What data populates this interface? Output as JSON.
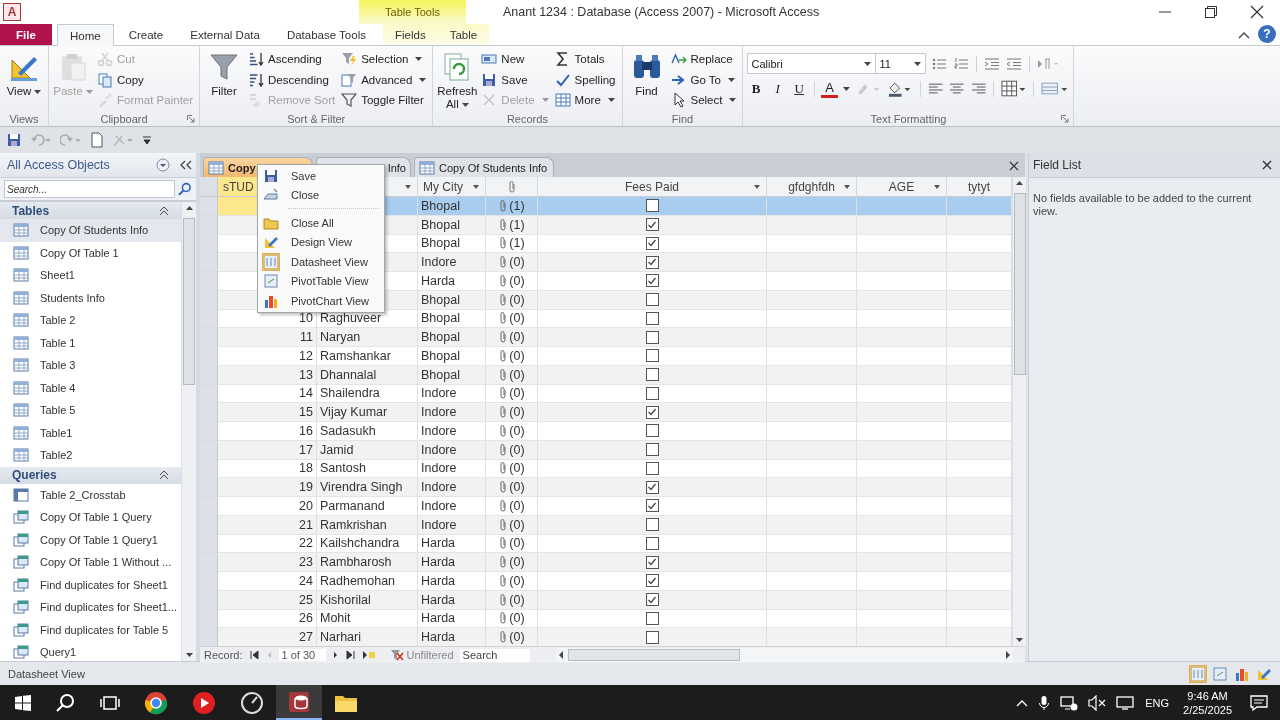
{
  "window": {
    "logo": "A",
    "context_group": "Table Tools",
    "title": "Anant 1234 : Database (Access 2007)  -  Microsoft Access",
    "help": "?"
  },
  "ribbon_tabs": [
    {
      "label": "File",
      "kind": "file",
      "selected": false
    },
    {
      "label": "Home",
      "kind": "tab",
      "selected": true
    },
    {
      "label": "Create",
      "kind": "tab",
      "selected": false
    },
    {
      "label": "External Data",
      "kind": "tab",
      "selected": false
    },
    {
      "label": "Database Tools",
      "kind": "tab",
      "selected": false
    },
    {
      "label": "Fields",
      "kind": "contextual",
      "selected": false
    },
    {
      "label": "Table",
      "kind": "contextual",
      "selected": false
    }
  ],
  "ribbon_groups": [
    {
      "label": "Views",
      "launcher": false,
      "columns": [
        [
          {
            "label": "View",
            "kind": "large",
            "dropdown": true,
            "disabled": false
          }
        ]
      ]
    },
    {
      "label": "Clipboard",
      "launcher": true,
      "columns": [
        [
          {
            "label": "Paste",
            "kind": "large",
            "dropdown": true,
            "disabled": true
          }
        ],
        [
          {
            "label": "Cut",
            "kind": "small",
            "dropdown": false,
            "disabled": true
          },
          {
            "label": "Copy",
            "kind": "small",
            "dropdown": false,
            "disabled": false
          },
          {
            "label": "Format Painter",
            "kind": "small",
            "dropdown": false,
            "disabled": true
          }
        ]
      ]
    },
    {
      "label": "Sort & Filter",
      "launcher": false,
      "columns": [
        [
          {
            "label": "Filter",
            "kind": "large",
            "dropdown": false,
            "disabled": false
          }
        ],
        [
          {
            "label": "Ascending",
            "kind": "small",
            "dropdown": false,
            "disabled": false
          },
          {
            "label": "Descending",
            "kind": "small",
            "dropdown": false,
            "disabled": false
          },
          {
            "label": "Remove Sort",
            "kind": "small",
            "dropdown": false,
            "disabled": true
          }
        ],
        [
          {
            "label": "Selection",
            "kind": "small",
            "dropdown": true,
            "disabled": false
          },
          {
            "label": "Advanced",
            "kind": "small",
            "dropdown": true,
            "disabled": false
          },
          {
            "label": "Toggle Filter",
            "kind": "small",
            "dropdown": false,
            "disabled": false
          }
        ]
      ]
    },
    {
      "label": "Records",
      "launcher": false,
      "columns": [
        [
          {
            "label": "Refresh All",
            "kind": "large",
            "dropdown": true,
            "disabled": false
          }
        ],
        [
          {
            "label": "New",
            "kind": "small",
            "dropdown": false,
            "disabled": false
          },
          {
            "label": "Save",
            "kind": "small",
            "dropdown": false,
            "disabled": false
          },
          {
            "label": "Delete",
            "kind": "small",
            "dropdown": true,
            "disabled": true
          }
        ],
        [
          {
            "label": "Totals",
            "kind": "small",
            "dropdown": false,
            "disabled": false
          },
          {
            "label": "Spelling",
            "kind": "small",
            "dropdown": false,
            "disabled": false
          },
          {
            "label": "More",
            "kind": "small",
            "dropdown": true,
            "disabled": false
          }
        ]
      ]
    },
    {
      "label": "Find",
      "launcher": false,
      "columns": [
        [
          {
            "label": "Find",
            "kind": "large",
            "dropdown": false,
            "disabled": false
          }
        ],
        [
          {
            "label": "Replace",
            "kind": "small",
            "dropdown": false,
            "disabled": false
          },
          {
            "label": "Go To",
            "kind": "small",
            "dropdown": true,
            "disabled": false
          },
          {
            "label": "Select",
            "kind": "small",
            "dropdown": true,
            "disabled": false
          }
        ]
      ]
    }
  ],
  "text_formatting": {
    "label": "Text Formatting",
    "launcher": true,
    "font": "Calibri",
    "size": "11",
    "style_buttons": [
      "B",
      "I",
      "U"
    ],
    "font_color": "A"
  },
  "nav_pane": {
    "title": "All Access Objects",
    "search_placeholder": "Search...",
    "sections": [
      {
        "title": "Tables",
        "expanded": true,
        "items": [
          {
            "label": "Copy Of Students Info",
            "kind": "table",
            "selected": true
          },
          {
            "label": "Copy Of Table 1",
            "kind": "table",
            "selected": false
          },
          {
            "label": "Sheet1",
            "kind": "table",
            "selected": false
          },
          {
            "label": "Students Info",
            "kind": "table",
            "selected": false
          },
          {
            "label": "Table  2",
            "kind": "table",
            "selected": false
          },
          {
            "label": "Table 1",
            "kind": "table",
            "selected": false
          },
          {
            "label": "Table 3",
            "kind": "table",
            "selected": false
          },
          {
            "label": "Table 4",
            "kind": "table",
            "selected": false
          },
          {
            "label": "Table 5",
            "kind": "table",
            "selected": false
          },
          {
            "label": "Table1",
            "kind": "table",
            "selected": false
          },
          {
            "label": "Table2",
            "kind": "table",
            "selected": false
          }
        ]
      },
      {
        "title": "Queries",
        "expanded": true,
        "items": [
          {
            "label": "Table  2_Crosstab",
            "kind": "crosstab",
            "selected": false
          },
          {
            "label": "Copy Of Table 1 Query",
            "kind": "query",
            "selected": false
          },
          {
            "label": "Copy Of Table 1 Query1",
            "kind": "query",
            "selected": false
          },
          {
            "label": "Copy Of Table 1 Without ...",
            "kind": "query",
            "selected": false
          },
          {
            "label": "Find duplicates for Sheet1",
            "kind": "query",
            "selected": false
          },
          {
            "label": "Find duplicates for Sheet1...",
            "kind": "query",
            "selected": false
          },
          {
            "label": "Find duplicates for Table 5",
            "kind": "query",
            "selected": false
          },
          {
            "label": "Query1",
            "kind": "query",
            "selected": false
          }
        ]
      }
    ]
  },
  "document_tabs": [
    {
      "label": "Copy",
      "selected": true
    },
    {
      "label": "Info",
      "selected": false
    },
    {
      "label": "Copy Of Students Info",
      "selected": false
    }
  ],
  "context_menu": {
    "items": [
      {
        "kind": "item",
        "label": "Save",
        "current": false
      },
      {
        "kind": "item",
        "label": "Close",
        "current": false
      },
      {
        "kind": "separator"
      },
      {
        "kind": "item",
        "label": "Close All",
        "current": false
      },
      {
        "kind": "item",
        "label": "Design View",
        "current": false
      },
      {
        "kind": "item",
        "label": "Datasheet View",
        "current": true
      },
      {
        "kind": "item",
        "label": "PivotTable View",
        "current": false
      },
      {
        "kind": "item",
        "label": "PivotChart View",
        "current": false
      }
    ]
  },
  "table": {
    "columns": [
      {
        "label": "sTUD",
        "kind": "text",
        "selected": true,
        "filter": false
      },
      {
        "kind": "text",
        "selected": false,
        "filter": true
      },
      {
        "label": "My City",
        "kind": "text",
        "selected": false,
        "filter": true
      },
      {
        "kind": "attachment",
        "selected": false,
        "filter": false
      },
      {
        "label": "Fees Paid",
        "kind": "check",
        "selected": false,
        "filter": true
      },
      {
        "label": "gfdghfdh",
        "kind": "text",
        "selected": false,
        "filter": true
      },
      {
        "label": "AGE",
        "kind": "text",
        "selected": false,
        "filter": true
      },
      {
        "label": "tytyt",
        "kind": "text",
        "selected": false,
        "filter": false
      }
    ],
    "rows": [
      {
        "city": "Bhopal",
        "attachments": "(1)",
        "fees_paid": false,
        "selected": true
      },
      {
        "city": "Bhopal",
        "attachments": "(1)",
        "fees_paid": true,
        "selected": false
      },
      {
        "city": "Bhopal",
        "attachments": "(1)",
        "fees_paid": true,
        "selected": false
      },
      {
        "city": "Indore",
        "attachments": "(0)",
        "fees_paid": true,
        "selected": false
      },
      {
        "city": "Harda",
        "attachments": "(0)",
        "fees_paid": true,
        "selected": false
      },
      {
        "city": "Bhopal",
        "attachments": "(0)",
        "fees_paid": false,
        "selected": false
      },
      {
        "id": "10",
        "name": "Raghuveer",
        "city": "Bhopal",
        "attachments": "(0)",
        "fees_paid": false,
        "selected": false
      },
      {
        "id": "11",
        "name": "Naryan",
        "city": "Bhopal",
        "attachments": "(0)",
        "fees_paid": false,
        "selected": false
      },
      {
        "id": "12",
        "name": "Ramshankar",
        "city": "Bhopal",
        "attachments": "(0)",
        "fees_paid": false,
        "selected": false
      },
      {
        "id": "13",
        "name": "Dhannalal",
        "city": "Bhopal",
        "attachments": "(0)",
        "fees_paid": false,
        "selected": false
      },
      {
        "id": "14",
        "name": "Shailendra",
        "city": "Indore",
        "attachments": "(0)",
        "fees_paid": false,
        "selected": false
      },
      {
        "id": "15",
        "name": "Vijay Kumar",
        "city": "Indore",
        "attachments": "(0)",
        "fees_paid": true,
        "selected": false
      },
      {
        "id": "16",
        "name": "Sadasukh",
        "city": "Indore",
        "attachments": "(0)",
        "fees_paid": false,
        "selected": false
      },
      {
        "id": "17",
        "name": "Jamid",
        "city": "Indore",
        "attachments": "(0)",
        "fees_paid": false,
        "selected": false
      },
      {
        "id": "18",
        "name": "Santosh",
        "city": "Indore",
        "attachments": "(0)",
        "fees_paid": false,
        "selected": false
      },
      {
        "id": "19",
        "name": "Virendra Singh",
        "city": "Indore",
        "attachments": "(0)",
        "fees_paid": true,
        "selected": false
      },
      {
        "id": "20",
        "name": "Parmanand",
        "city": "Indore",
        "attachments": "(0)",
        "fees_paid": true,
        "selected": false
      },
      {
        "id": "21",
        "name": "Ramkrishan",
        "city": "Indore",
        "attachments": "(0)",
        "fees_paid": false,
        "selected": false
      },
      {
        "id": "22",
        "name": "Kailshchandra",
        "city": "Harda",
        "attachments": "(0)",
        "fees_paid": false,
        "selected": false
      },
      {
        "id": "23",
        "name": "Rambharosh",
        "city": "Harda",
        "attachments": "(0)",
        "fees_paid": true,
        "selected": false
      },
      {
        "id": "24",
        "name": "Radhemohan",
        "city": "Harda",
        "attachments": "(0)",
        "fees_paid": true,
        "selected": false
      },
      {
        "id": "25",
        "name": "Kishorilal",
        "city": "Harda",
        "attachments": "(0)",
        "fees_paid": true,
        "selected": false
      },
      {
        "id": "26",
        "name": "Mohit",
        "city": "Harda",
        "attachments": "(0)",
        "fees_paid": false,
        "selected": false
      },
      {
        "id": "27",
        "name": "Narhari",
        "city": "Harda",
        "attachments": "(0)",
        "fees_paid": false,
        "selected": false
      }
    ]
  },
  "record_nav": {
    "label": "Record:",
    "position": "1 of 30",
    "filter_status": "Unfiltered",
    "search_placeholder": "Search"
  },
  "field_list": {
    "title": "Field List",
    "message": "No fields available to be added to the current view."
  },
  "status_bar": {
    "text": "Datasheet View"
  },
  "taskbar": {
    "language": "ENG",
    "time": "9:46 AM",
    "date": "2/25/2025"
  }
}
